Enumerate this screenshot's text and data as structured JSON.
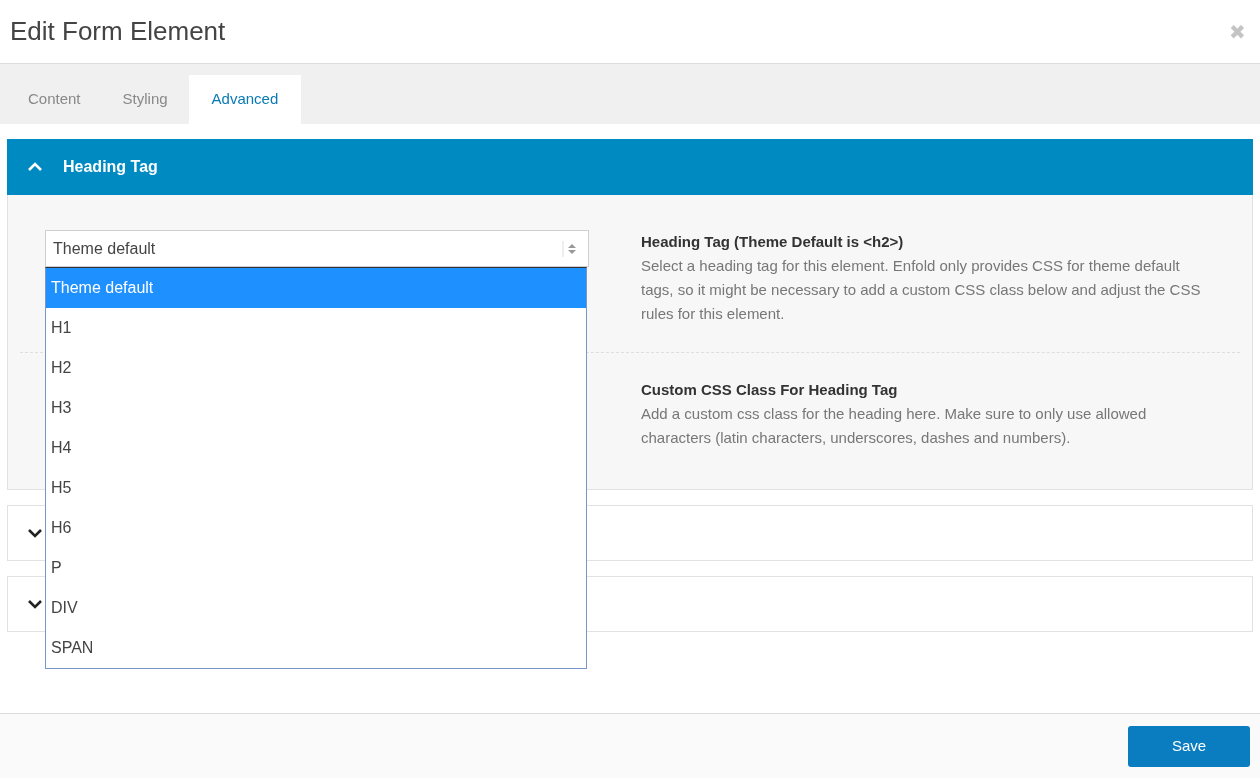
{
  "dialog": {
    "title": "Edit Form Element",
    "close": "✖"
  },
  "tabs": [
    {
      "label": "Content",
      "selected": false
    },
    {
      "label": "Styling",
      "selected": false
    },
    {
      "label": "Advanced",
      "selected": true
    }
  ],
  "sections": [
    {
      "title": "Heading Tag",
      "expanded": true,
      "select": {
        "value": "Theme default",
        "open": true,
        "options": [
          {
            "label": "Theme default",
            "selected": true
          },
          {
            "label": "H1",
            "selected": false
          },
          {
            "label": "H2",
            "selected": false
          },
          {
            "label": "H3",
            "selected": false
          },
          {
            "label": "H4",
            "selected": false
          },
          {
            "label": "H5",
            "selected": false
          },
          {
            "label": "H6",
            "selected": false
          },
          {
            "label": "P",
            "selected": false
          },
          {
            "label": "DIV",
            "selected": false
          },
          {
            "label": "SPAN",
            "selected": false
          }
        ]
      },
      "fields": [
        {
          "label": "Heading Tag (Theme Default is <h2>)",
          "description": "Select a heading tag for this element. Enfold only provides CSS for theme default tags, so it might be necessary to add a custom CSS class below and adjust the CSS rules for this element."
        },
        {
          "label": "Custom CSS Class For Heading Tag",
          "description": "Add a custom css class for the heading here. Make sure to only use allowed characters (latin characters, underscores, dashes and numbers)."
        }
      ]
    },
    {
      "expanded": false
    },
    {
      "expanded": false
    }
  ],
  "footer": {
    "save": "Save"
  }
}
